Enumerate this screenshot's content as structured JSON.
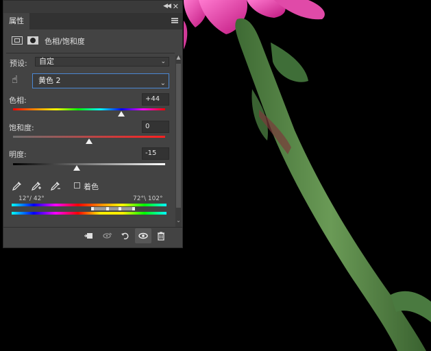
{
  "panel": {
    "tab_label": "属性",
    "collapse_icon": "double-chevron-icon",
    "close_icon": "close-icon",
    "menu_icon": "panel-menu-icon",
    "adjustment_title": "色相/饱和度",
    "header_icons": [
      "adjustment-layer-icon",
      "layer-mask-icon"
    ]
  },
  "preset": {
    "label": "预设:",
    "value": "自定"
  },
  "range": {
    "value": "黄色 2",
    "icon": "targeted-adjustment-hand-icon"
  },
  "hue": {
    "label": "色相:",
    "value": "+44",
    "slider_fraction": 0.71
  },
  "saturation": {
    "label": "饱和度:",
    "value": "0",
    "slider_fraction": 0.5
  },
  "lightness": {
    "label": "明度:",
    "value": "-15",
    "slider_fraction": 0.42
  },
  "eyedroppers": [
    "eyedropper-icon",
    "eyedropper-add-icon",
    "eyedropper-subtract-icon"
  ],
  "colorize": {
    "label": "着色",
    "checked": false
  },
  "color_range": {
    "left_label": "12°/ 42°",
    "right_label": "72°\\ 102°"
  },
  "bottom_toolbar": [
    "clip-to-layer-icon",
    "view-previous-icon",
    "reset-icon",
    "visibility-eye-icon",
    "delete-trash-icon"
  ],
  "colors": {
    "panel_bg": "#434343",
    "accent_border": "#4b88d4",
    "petal": "#e040a0",
    "stem": "#5a8a4a"
  }
}
